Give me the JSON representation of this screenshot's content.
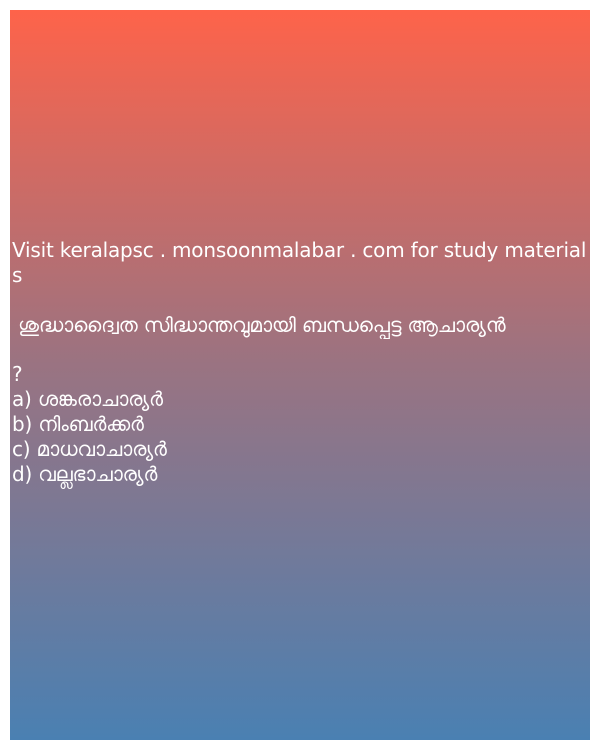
{
  "promo_text": "Visit keralapsc . monsoonmalabar . com for study materials",
  "question": " ശുദ്ധാദ്വൈത സിദ്ധാന്തവുമായി ബന്ധപ്പെട്ട ആചാര്യൻ",
  "question_mark": "?",
  "options": [
    "a) ശങ്കരാചാര്യർ",
    "b) നിംബർക്കർ",
    "c) മാധവാചാര്യർ",
    "d) വല്ലഭാചാര്യർ"
  ],
  "colors": {
    "gradient_top": "#fe634a",
    "gradient_mid": "#9b7381",
    "gradient_bottom": "#4a80b2",
    "text": "#ffffff"
  }
}
